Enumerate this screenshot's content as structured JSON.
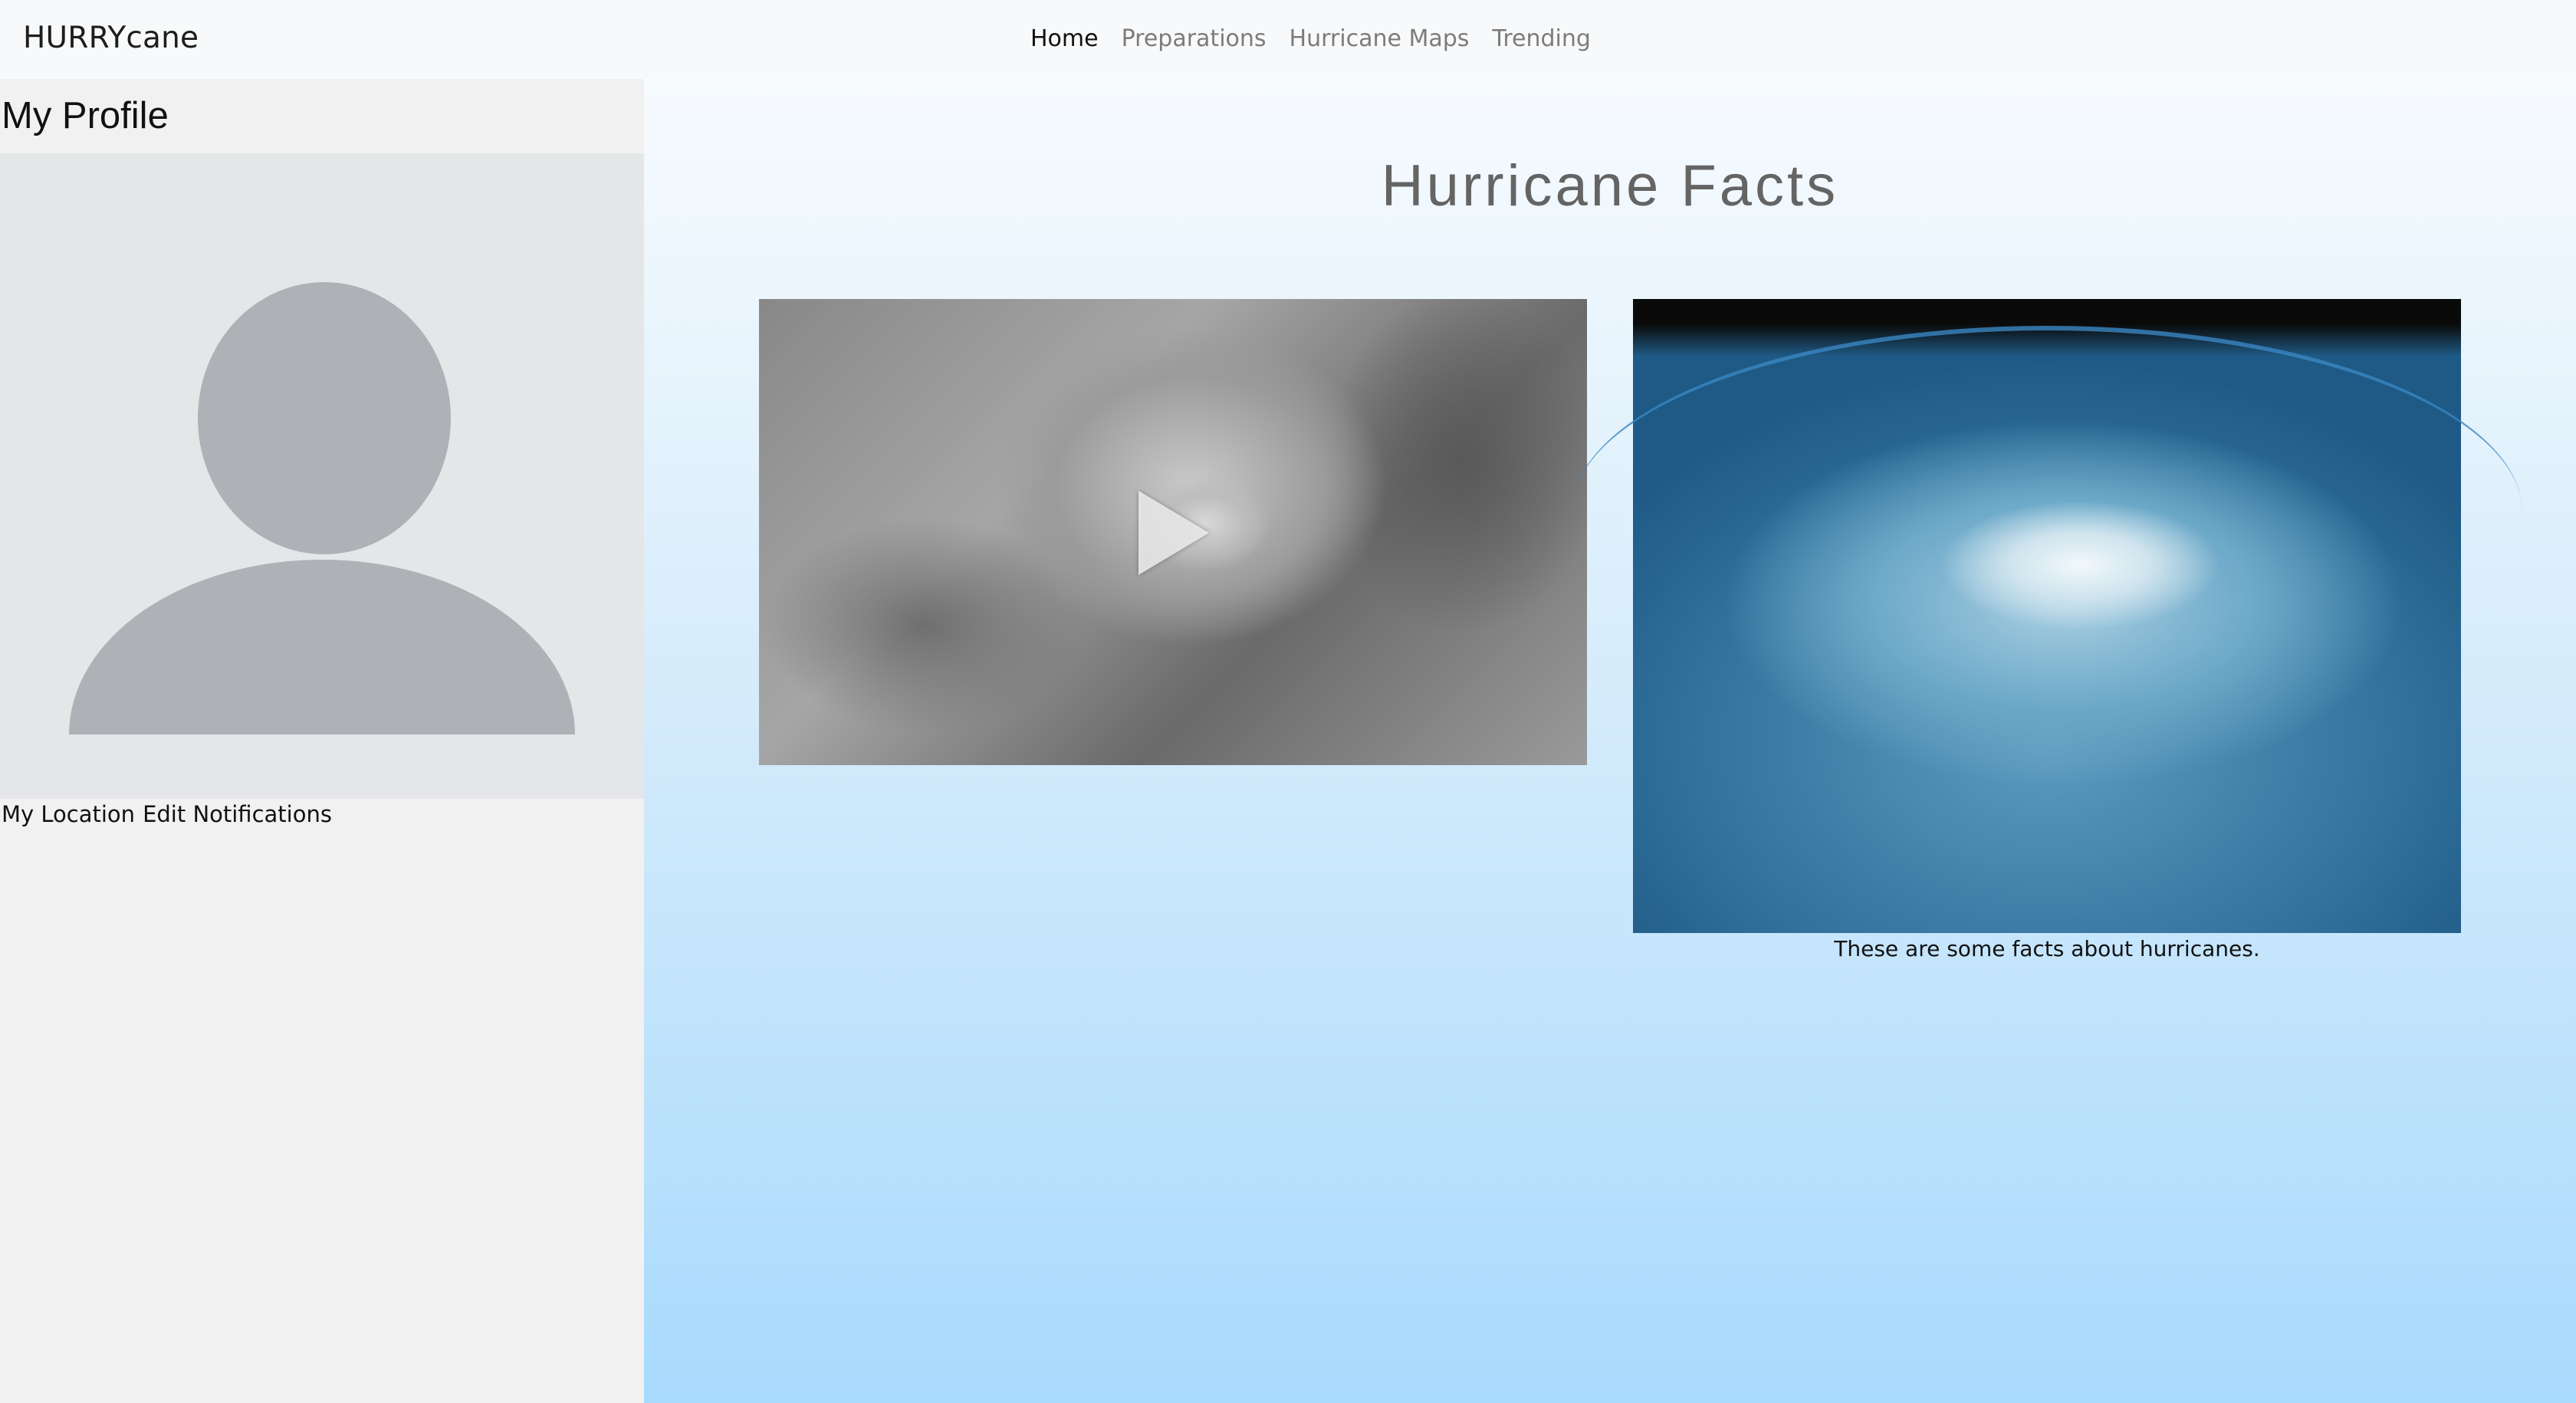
{
  "nav": {
    "brand": "HURRYcane",
    "links": [
      "Home",
      "Preparations",
      "Hurricane Maps",
      "Trending"
    ]
  },
  "sidebar": {
    "title": "My Profile",
    "links": [
      "My Location",
      "Edit Notifications"
    ]
  },
  "main": {
    "title": "Hurricane Facts",
    "caption": "These are some facts about hurricanes."
  }
}
